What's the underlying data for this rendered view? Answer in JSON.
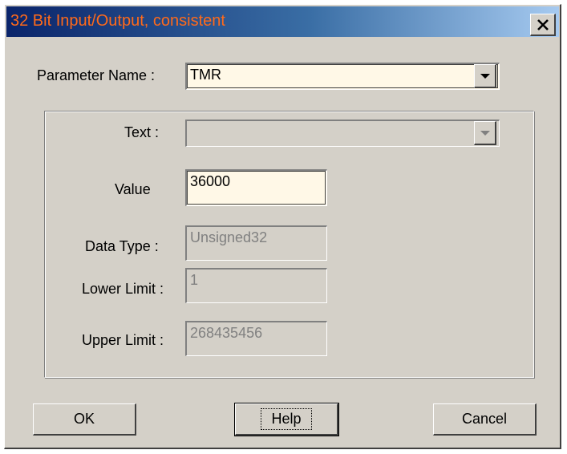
{
  "window": {
    "title": "32 Bit Input/Output, consistent",
    "close_symbol": "X"
  },
  "parameter_name": {
    "label": "Parameter Name :",
    "value": "TMR"
  },
  "group": {
    "text": {
      "label": "Text :",
      "value": ""
    },
    "value": {
      "label": "Value",
      "value": "36000"
    },
    "data_type": {
      "label": "Data Type :",
      "value": "Unsigned32"
    },
    "lower_limit": {
      "label": "Lower Limit :",
      "value": "1"
    },
    "upper_limit": {
      "label": "Upper Limit :",
      "value": "268435456"
    }
  },
  "buttons": {
    "ok": "OK",
    "help": "Help",
    "cancel": "Cancel"
  },
  "colors": {
    "title_text": "#ff6a1a",
    "title_bar_start": "#0a246a",
    "title_bar_end": "#a6caf0",
    "dialog_bg": "#d4d0c8",
    "active_field_bg": "#fff8e7",
    "disabled_text": "#808080"
  },
  "icons": {
    "close": "close-icon",
    "dropdown": "chevron-down-icon"
  }
}
